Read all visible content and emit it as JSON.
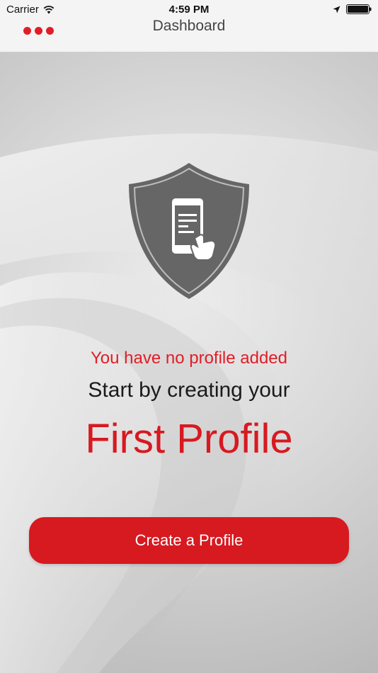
{
  "status_bar": {
    "carrier": "Carrier",
    "time": "4:59 PM"
  },
  "nav": {
    "title": "Dashboard"
  },
  "empty_state": {
    "line1": "You have no profile added",
    "line2": "Start by creating your",
    "line3": "First Profile"
  },
  "actions": {
    "create_label": "Create a Profile"
  },
  "icons": {
    "menu": "more-dots-icon",
    "hero": "shield-phone-tap-icon",
    "wifi": "wifi-icon",
    "location": "location-arrow-icon",
    "battery": "battery-icon"
  },
  "colors": {
    "accent": "#d71920",
    "text_dark": "#1a1a1a",
    "shield_gray": "#6b6b6b"
  }
}
